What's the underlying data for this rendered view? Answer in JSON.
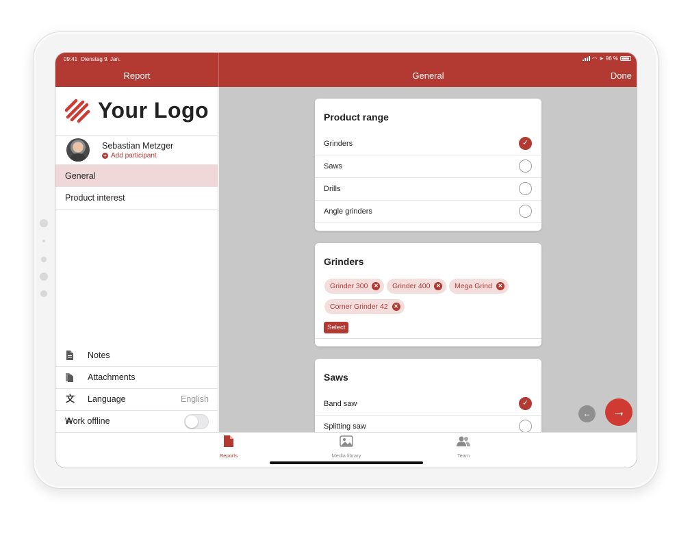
{
  "status": {
    "time": "09:41",
    "date": "Dienstag 9. Jan.",
    "battery": "96 %"
  },
  "header": {
    "left_title": "Report",
    "center_title": "General",
    "done_label": "Done"
  },
  "sidebar": {
    "logo_text": "Your Logo",
    "user": {
      "name": "Sebastian Metzger",
      "add_participant": "Add participant"
    },
    "items": [
      {
        "label": "General",
        "active": true
      },
      {
        "label": "Product interest",
        "active": false
      }
    ],
    "footer": {
      "notes": "Notes",
      "attachments": "Attachments",
      "language_label": "Language",
      "language_value": "English",
      "work_offline": "Work offline",
      "work_offline_on": false
    }
  },
  "main": {
    "product_range": {
      "title": "Product range",
      "options": [
        {
          "label": "Grinders",
          "checked": true
        },
        {
          "label": "Saws",
          "checked": false
        },
        {
          "label": "Drills",
          "checked": false
        },
        {
          "label": "Angle grinders",
          "checked": false
        }
      ]
    },
    "grinders": {
      "title": "Grinders",
      "chips": [
        "Grinder 300",
        "Grinder 400",
        "Mega Grind",
        "Corner Grinder 42"
      ],
      "select_label": "Select"
    },
    "saws": {
      "title": "Saws",
      "options": [
        {
          "label": "Band saw",
          "checked": true
        },
        {
          "label": "Splitting saw",
          "checked": false
        }
      ]
    }
  },
  "tabbar": {
    "reports": "Reports",
    "media": "Media library",
    "team": "Team"
  },
  "colors": {
    "brand": "#b33a33",
    "next_button": "#cf3b32",
    "active_row": "#efd8d7"
  }
}
